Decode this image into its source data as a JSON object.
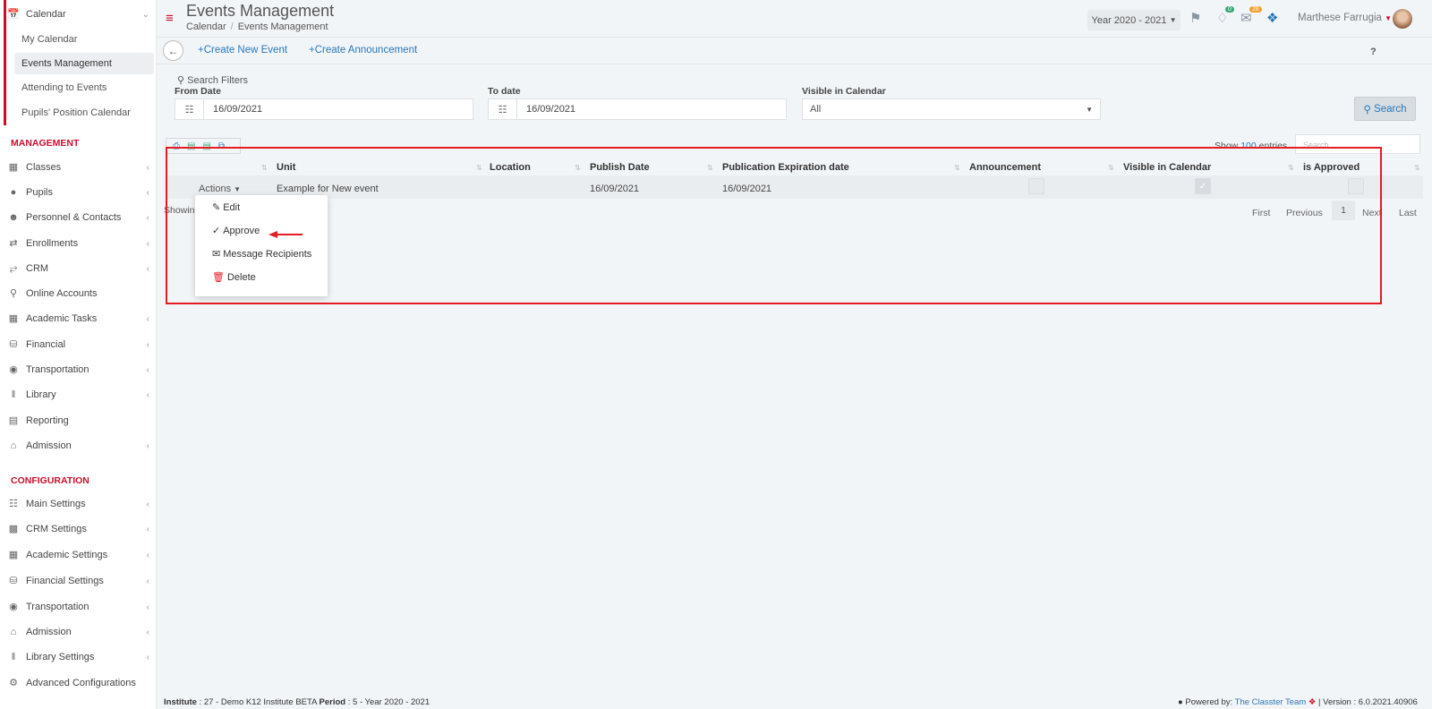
{
  "sidebar": {
    "calendar": {
      "label": "Calendar",
      "icon": "calendar-icon",
      "items": [
        {
          "label": "My Calendar"
        },
        {
          "label": "Events Management",
          "active": true
        },
        {
          "label": "Attending to Events"
        },
        {
          "label": "Pupils' Position Calendar"
        }
      ]
    },
    "management_title": "MANAGEMENT",
    "management": [
      {
        "label": "Classes",
        "icon": "classes-icon"
      },
      {
        "label": "Pupils",
        "icon": "pupils-icon"
      },
      {
        "label": "Personnel & Contacts",
        "icon": "person-icon"
      },
      {
        "label": "Enrollments",
        "icon": "exchange-icon"
      },
      {
        "label": "CRM",
        "icon": "crm-icon"
      },
      {
        "label": "Online Accounts",
        "icon": "key-icon"
      },
      {
        "label": "Academic Tasks",
        "icon": "grid-icon"
      },
      {
        "label": "Financial",
        "icon": "coins-icon"
      },
      {
        "label": "Transportation",
        "icon": "bus-icon"
      },
      {
        "label": "Library",
        "icon": "library-icon"
      },
      {
        "label": "Reporting",
        "icon": "report-icon"
      },
      {
        "label": "Admission",
        "icon": "institution-icon"
      }
    ],
    "configuration_title": "CONFIGURATION",
    "configuration": [
      {
        "label": "Main Settings",
        "icon": "sliders-icon"
      },
      {
        "label": "CRM Settings",
        "icon": "crm-settings-icon"
      },
      {
        "label": "Academic Settings",
        "icon": "grid-icon"
      },
      {
        "label": "Financial Settings",
        "icon": "coins-icon"
      },
      {
        "label": "Transportation",
        "icon": "bus-icon"
      },
      {
        "label": "Admission",
        "icon": "institution-icon"
      },
      {
        "label": "Library Settings",
        "icon": "library-icon"
      },
      {
        "label": "Advanced Configurations",
        "icon": "cogs-icon"
      }
    ]
  },
  "header": {
    "title": "Events Management",
    "breadcrumb": [
      "Calendar",
      "Events Management"
    ],
    "year": "Year 2020 - 2021",
    "notifications_count": "0",
    "messages_count": "28",
    "user_name": "Marthese Farrugia"
  },
  "toolbar": {
    "create_event": "Create New Event",
    "create_announcement": "Create Announcement",
    "help": "?"
  },
  "filters": {
    "title": "Search Filters",
    "from_label": "From Date",
    "from_value": "16/09/2021",
    "to_label": "To date",
    "to_value": "16/09/2021",
    "visible_label": "Visible in Calendar",
    "visible_value": "All",
    "search_button": "Search"
  },
  "table": {
    "show_label": "Show",
    "show_count": "100",
    "entries_label": "entries",
    "search_placeholder": "Search...",
    "columns": [
      "Unit",
      "Location",
      "Publish Date",
      "Publication Expiration date",
      "Announcement",
      "Visible in Calendar",
      "is Approved"
    ],
    "rows": [
      {
        "actions": "Actions",
        "unit": "Example for New event",
        "location": "",
        "publish_date": "16/09/2021",
        "expiration_date": "16/09/2021",
        "announcement": false,
        "visible": true,
        "approved": false
      }
    ],
    "showing_text": "Showin",
    "pagination": {
      "first": "First",
      "previous": "Previous",
      "page": "1",
      "next": "Next",
      "last": "Last"
    }
  },
  "actions_menu": [
    "Edit",
    "Approve",
    "Message Recipients",
    "Delete"
  ],
  "footer": {
    "institute_label": "Institute",
    "institute_value": ": 27 - Demo K12 Institute BETA",
    "period_label": "Period",
    "period_value": ": 5 - Year 2020 - 2021",
    "powered_by": "Powered by:",
    "team": "The Classter Team",
    "version": "| Version : 6.0.2021.40906"
  },
  "colors": {
    "accent_red": "#c8102e",
    "link_blue": "#2a77b8",
    "highlight": "#e41c23"
  }
}
